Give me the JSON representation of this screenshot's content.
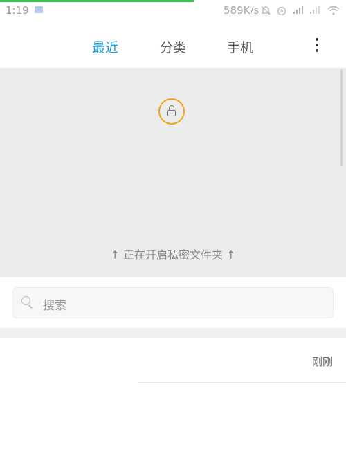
{
  "status_bar": {
    "time": "1:19",
    "net_speed": "589K/s",
    "icons": [
      "notification-icon",
      "bell-off-icon",
      "alarm-icon",
      "signal-icon",
      "signal-icon",
      "wifi-icon"
    ]
  },
  "tabs": [
    {
      "label": "最近",
      "active": true
    },
    {
      "label": "分类",
      "active": false
    },
    {
      "label": "手机",
      "active": false
    }
  ],
  "private_folder": {
    "text": "↑ 正在开启私密文件夹 ↑",
    "lock_color": "#f0a31a"
  },
  "search": {
    "placeholder": "搜索"
  },
  "recent_items": [
    {
      "time_label": "刚刚"
    }
  ],
  "colors": {
    "accent": "#1f9bd6",
    "progress": "#36c24a"
  }
}
